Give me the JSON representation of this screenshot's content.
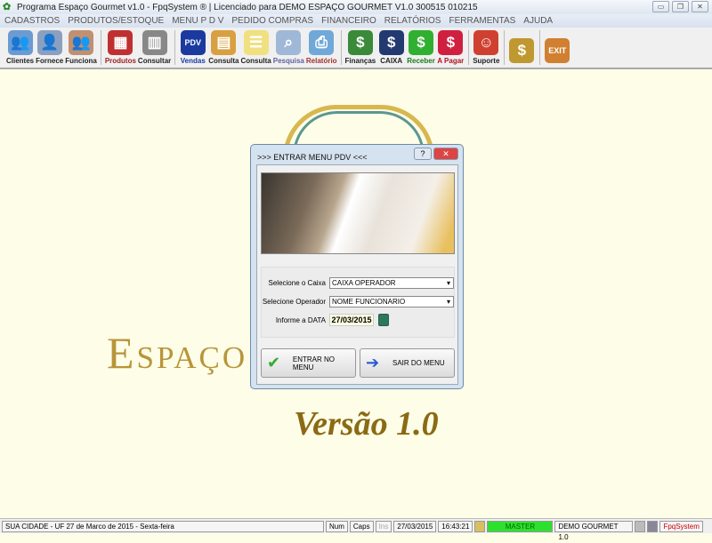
{
  "window": {
    "title": "Programa Espaço Gourmet v1.0 - FpqSystem ® | Licenciado para  DEMO ESPAÇO GOURMET V1.0 300515 010215",
    "minimize": "▭",
    "restore": "❐",
    "close": "✕"
  },
  "menu": [
    "CADASTROS",
    "PRODUTOS/ESTOQUE",
    "MENU P D V",
    "PEDIDO COMPRAS",
    "FINANCEIRO",
    "RELATÓRIOS",
    "FERRAMENTAS",
    "AJUDA"
  ],
  "toolbar": [
    {
      "label": "Clientes",
      "icon": "👥",
      "color": "#6b9bd1",
      "lc": "#222"
    },
    {
      "label": "Fornece",
      "icon": "👤",
      "color": "#8aa0c0",
      "lc": "#222"
    },
    {
      "label": "Funciona",
      "icon": "👥",
      "color": "#c09070",
      "lc": "#222"
    },
    {
      "sep": true
    },
    {
      "label": "Produtos",
      "icon": "▦",
      "color": "#c03030",
      "lc": "#a02020"
    },
    {
      "label": "Consultar",
      "icon": "▥",
      "color": "#888888",
      "lc": "#222"
    },
    {
      "sep": true
    },
    {
      "label": "Vendas",
      "icon": "PDV",
      "color": "#1a3aa0",
      "lc": "#1a3aa0"
    },
    {
      "label": "Consulta",
      "icon": "▤",
      "color": "#d8a040",
      "lc": "#222"
    },
    {
      "label": "Consulta",
      "icon": "☰",
      "color": "#f0e080",
      "lc": "#222"
    },
    {
      "label": "Pesquisa",
      "icon": "⌕",
      "color": "#a0b8d8",
      "lc": "#6060a0"
    },
    {
      "label": "Relatório",
      "icon": "⎙",
      "color": "#70a8d8",
      "lc": "#a03030"
    },
    {
      "sep": true
    },
    {
      "label": "Finanças",
      "icon": "$",
      "color": "#3a8a3a",
      "lc": "#222"
    },
    {
      "label": "CAIXA",
      "icon": "$",
      "color": "#223a70",
      "lc": "#222"
    },
    {
      "label": "Receber",
      "icon": "$",
      "color": "#30b030",
      "lc": "#1a7a1a"
    },
    {
      "label": "A Pagar",
      "icon": "$",
      "color": "#d02040",
      "lc": "#b01020"
    },
    {
      "sep": true
    },
    {
      "label": "Suporte",
      "icon": "☺",
      "color": "#d04030",
      "lc": "#222"
    },
    {
      "sep": true
    },
    {
      "label": "",
      "icon": "$",
      "color": "#c09830",
      "lc": "#222"
    },
    {
      "sep": true
    },
    {
      "label": "",
      "icon": "EXIT",
      "color": "#d08030",
      "lc": "#222"
    }
  ],
  "logo": {
    "title": "Espaço Gourmet",
    "version": "Versão 1.0"
  },
  "dialog": {
    "title": ">>> ENTRAR MENU PDV <<<",
    "help": "?",
    "close": "✕",
    "caixa_label": "Selecione o Caixa",
    "caixa_value": "CAIXA OPERADOR",
    "operador_label": "Selecione Operador",
    "operador_value": "NOME FUNCIONARIO",
    "data_label": "Informe a DATA",
    "data_value": "27/03/2015",
    "enter_label": "ENTRAR NO MENU",
    "exit_label": "SAIR DO MENU"
  },
  "status": {
    "location": "SUA CIDADE - UF 27 de Marco de 2015 - Sexta-feira",
    "num": "Num",
    "caps": "Caps",
    "ins": "Ins",
    "date": "27/03/2015",
    "time": "16:43:21",
    "user": "MASTER",
    "company": "DEMO GOURMET 1.0",
    "brand": "FpqSystem"
  }
}
